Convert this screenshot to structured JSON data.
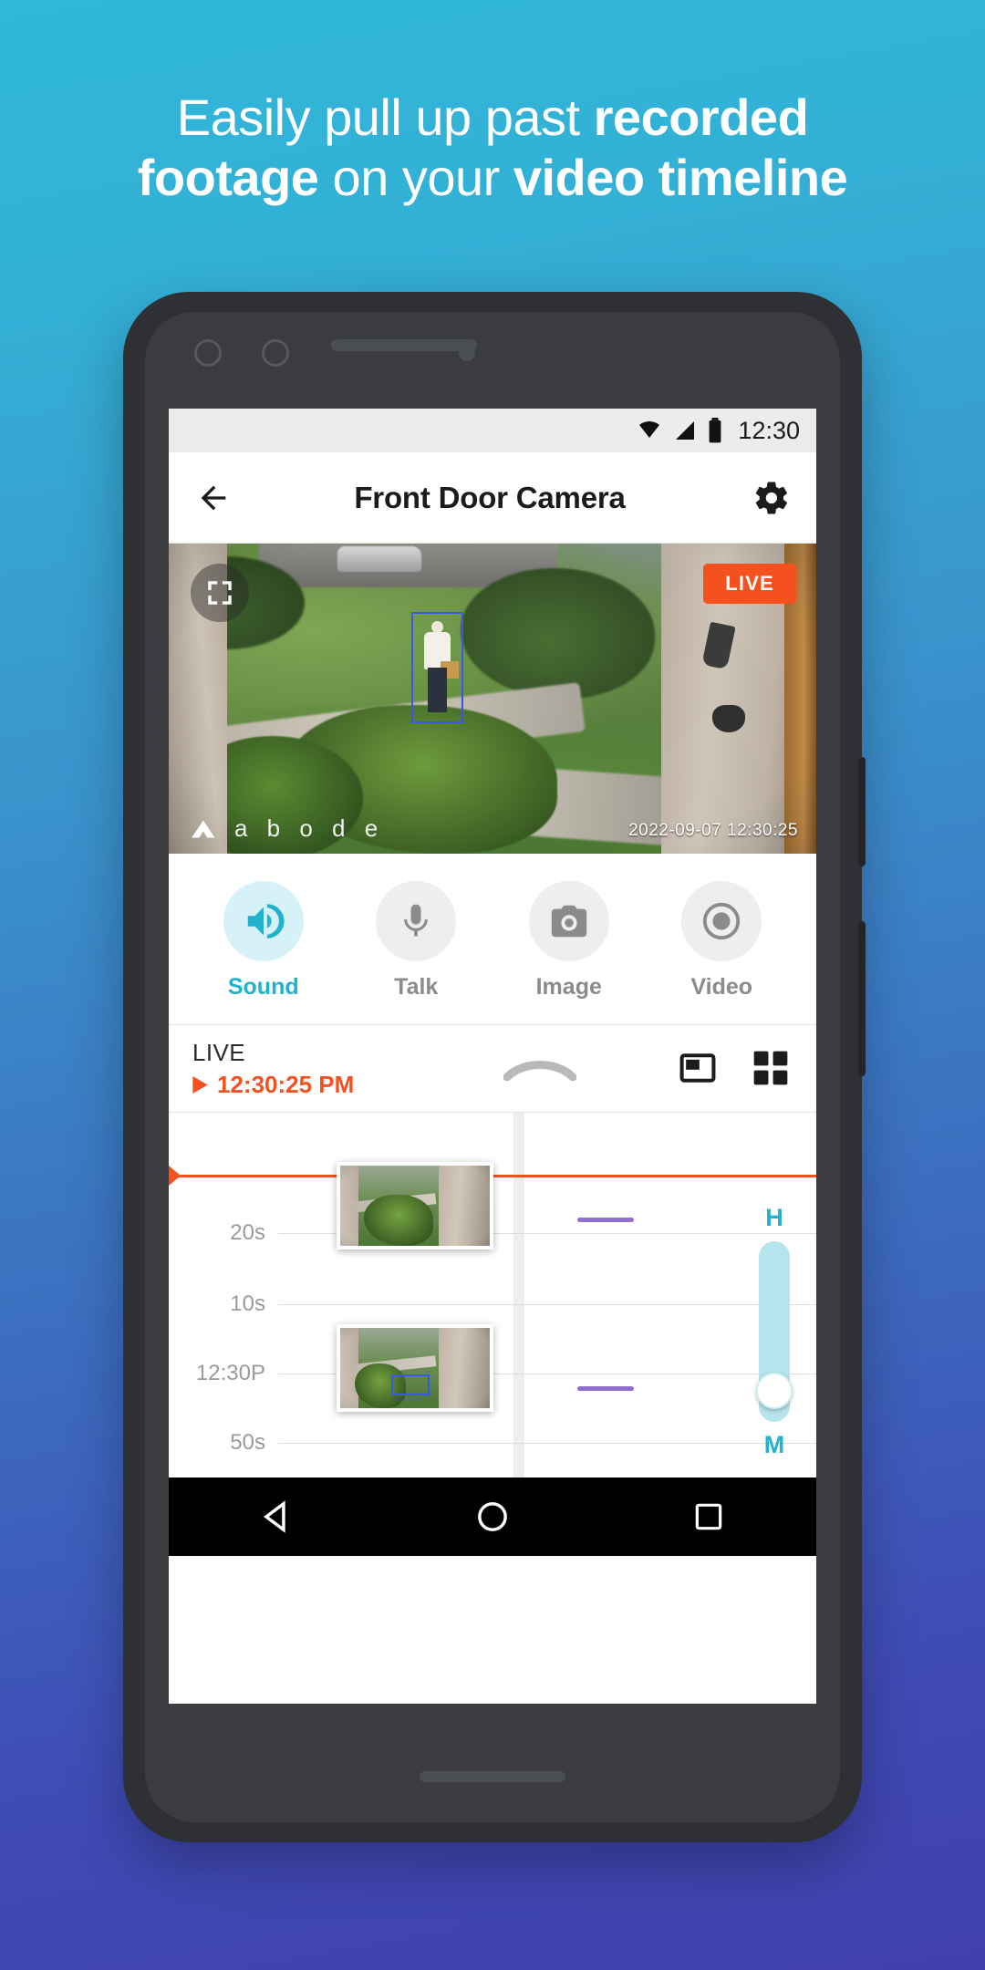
{
  "promo": {
    "line1_plain": "Easily pull up past ",
    "line1_bold": "recorded",
    "line2_bold_a": "footage",
    "line2_plain": " on your ",
    "line2_bold_b": "video timeline"
  },
  "status_bar": {
    "time": "12:30",
    "icons": [
      "wifi-icon",
      "signal-icon",
      "battery-icon"
    ]
  },
  "app_bar": {
    "back_icon": "back-arrow-icon",
    "title": "Front Door Camera",
    "settings_icon": "gear-icon"
  },
  "video": {
    "fullscreen_icon": "fullscreen-icon",
    "live_badge": "LIVE",
    "brand": "a b o d e",
    "timestamp": "2022-09-07 12:30:25"
  },
  "controls": [
    {
      "label": "Sound",
      "icon": "speaker-icon",
      "active": true
    },
    {
      "label": "Talk",
      "icon": "microphone-icon",
      "active": false
    },
    {
      "label": "Image",
      "icon": "camera-icon",
      "active": false
    },
    {
      "label": "Video",
      "icon": "record-icon",
      "active": false
    }
  ],
  "live_bar": {
    "live_label": "LIVE",
    "time": "12:30:25 PM",
    "collapse_icon": "chevron-up-icon",
    "pip_icon": "picture-in-picture-icon",
    "grid_icon": "grid-view-icon"
  },
  "timeline": {
    "tick_labels": [
      "20s",
      "10s",
      "12:30P",
      "50s"
    ],
    "hm_top": "H",
    "hm_bottom": "M",
    "accent_red": "#f4511e",
    "accent_teal": "#21b3ce",
    "segment_color": "#8e6fd0"
  },
  "nav_bar": {
    "back_icon": "nav-back-triangle-icon",
    "home_icon": "nav-home-circle-icon",
    "recents_icon": "nav-recents-square-icon"
  }
}
